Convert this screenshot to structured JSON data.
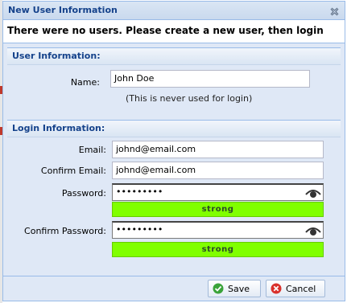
{
  "dialog": {
    "title": "New User Information",
    "message": "There were no users.  Please create a new user, then login",
    "close_icon": "close-icon"
  },
  "user_section": {
    "title": "User Information:",
    "name_label": "Name:",
    "name_value": "John Doe",
    "name_hint": "(This is never used for login)"
  },
  "login_section": {
    "title": "Login Information:",
    "email_label": "Email:",
    "email_value": "johnd@email.com",
    "confirm_email_label": "Confirm Email:",
    "confirm_email_value": "johnd@email.com",
    "password_label": "Password:",
    "password_value": "•••••••••",
    "password_strength": "strong",
    "confirm_password_label": "Confirm  Password:",
    "confirm_password_value": "•••••••••",
    "confirm_password_strength": "strong",
    "reveal_icon": "eye-icon"
  },
  "footer": {
    "save_label": "Save",
    "cancel_label": "Cancel",
    "save_icon": "checkmark-icon",
    "cancel_icon": "cancel-icon"
  },
  "colors": {
    "strength_strong": "#80ff00",
    "header_text": "#15428b",
    "dialog_bg": "#dfe8f6"
  }
}
